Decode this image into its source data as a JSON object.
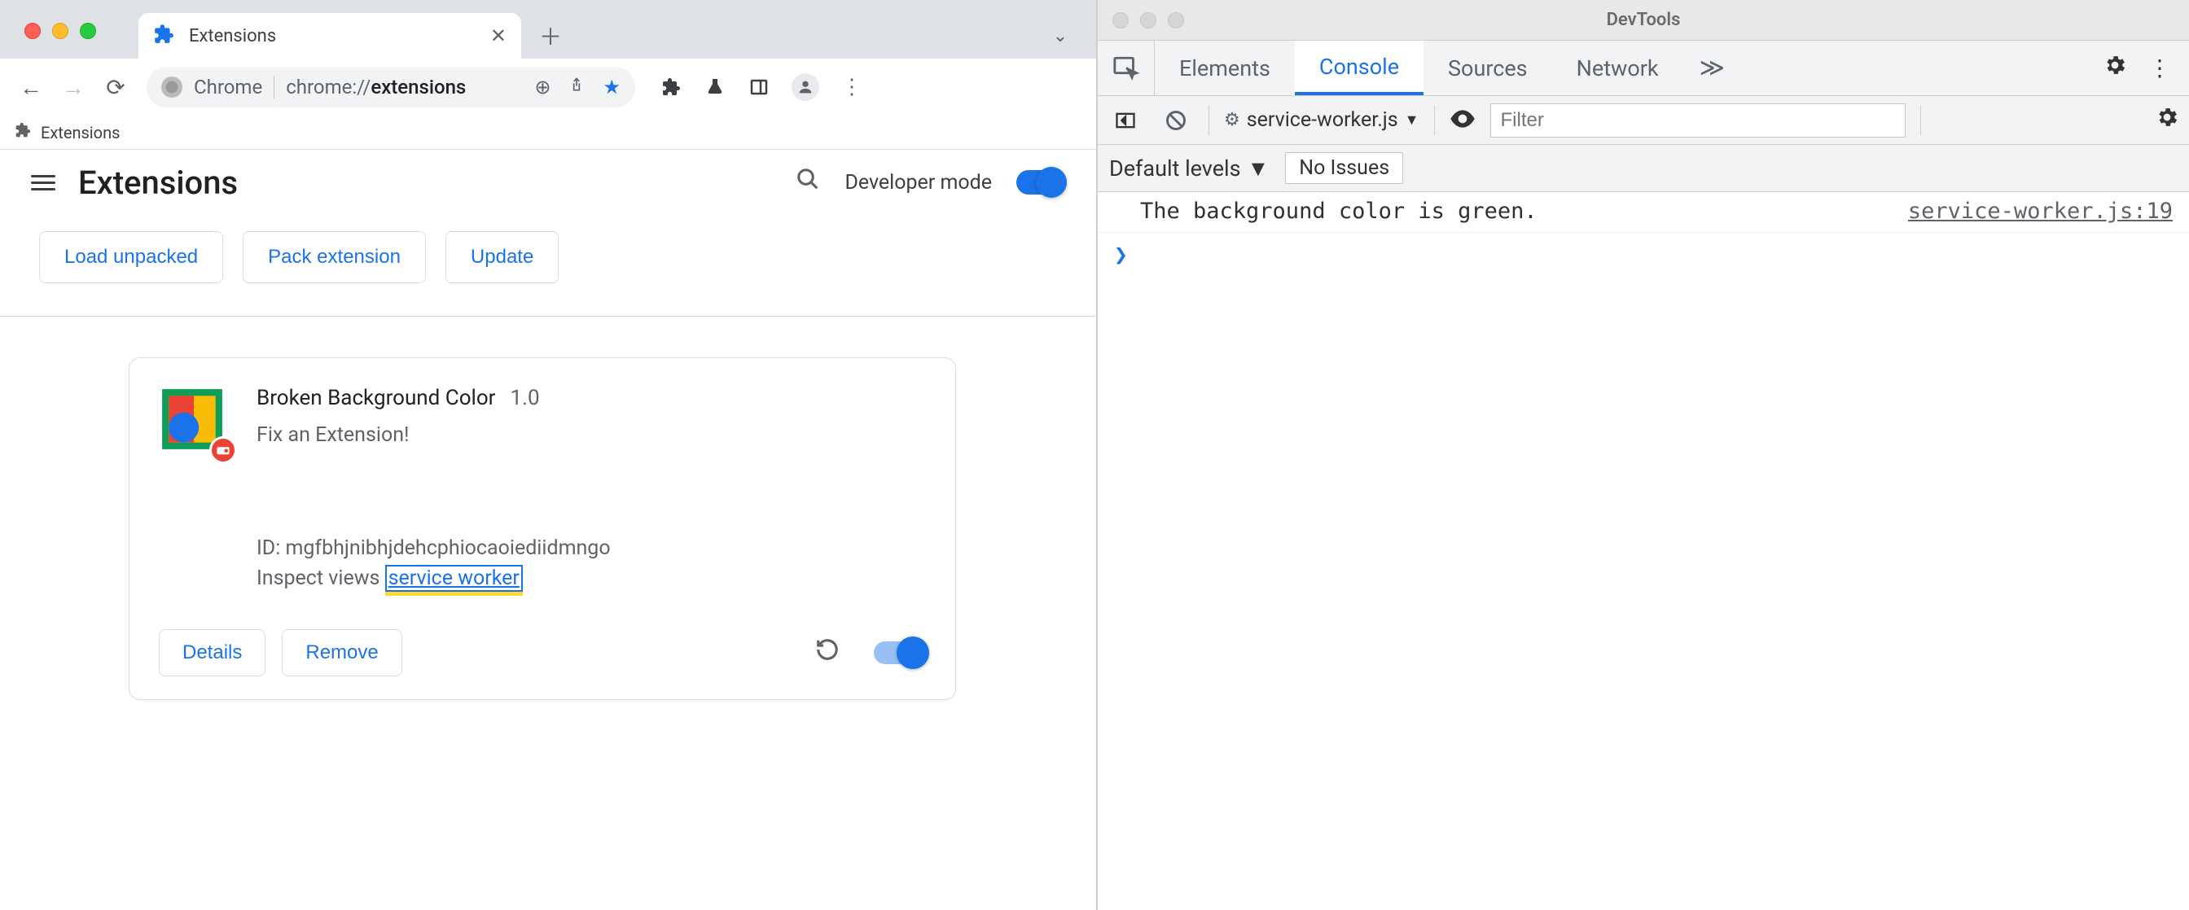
{
  "chrome": {
    "tab": {
      "title": "Extensions"
    },
    "omnibox": {
      "origin_label": "Chrome",
      "url_prefix": "chrome://",
      "url_bold": "extensions"
    },
    "bookmark": {
      "label": "Extensions"
    },
    "extensions_page": {
      "title": "Extensions",
      "developer_mode_label": "Developer mode",
      "buttons": {
        "load_unpacked": "Load unpacked",
        "pack_extension": "Pack extension",
        "update": "Update"
      },
      "card": {
        "name": "Broken Background Color",
        "version": "1.0",
        "description": "Fix an Extension!",
        "id_label": "ID: mgfbhjnibhjdehcphiocaoiediidmngo",
        "inspect_label": "Inspect views ",
        "service_worker_link": "service worker",
        "details_btn": "Details",
        "remove_btn": "Remove"
      }
    }
  },
  "devtools": {
    "window_title": "DevTools",
    "tabs": {
      "elements": "Elements",
      "console": "Console",
      "sources": "Sources",
      "network": "Network"
    },
    "toolbar": {
      "context": "service-worker.js",
      "filter_placeholder": "Filter",
      "levels": "Default levels",
      "issues": "No Issues"
    },
    "console": {
      "message": "The background color is green.",
      "source": "service-worker.js:19"
    }
  }
}
